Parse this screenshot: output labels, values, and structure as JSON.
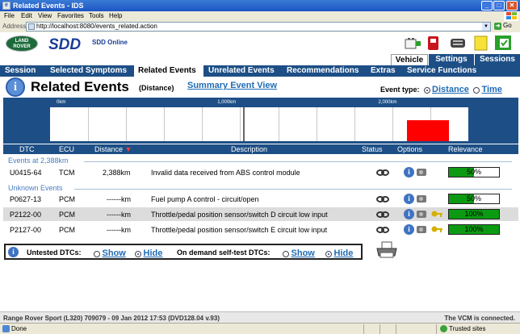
{
  "window": {
    "title": "Related Events - IDS",
    "minimize": "_",
    "maximize": "□",
    "close": "✕"
  },
  "menu": [
    "File",
    "Edit",
    "View",
    "Favorites",
    "Tools",
    "Help"
  ],
  "address": {
    "label": "Address",
    "url": "http://localhost:8080/events_related.action",
    "go": "Go"
  },
  "header": {
    "logo_text": "LAND ROVER",
    "brand": "SDD",
    "brand_sub": "SDD Online",
    "tabs": [
      {
        "label": "Vehicle",
        "active": true
      },
      {
        "label": "Settings",
        "active": false
      },
      {
        "label": "Sessions",
        "active": false
      }
    ]
  },
  "nav": [
    {
      "label": "Session",
      "active": false
    },
    {
      "label": "Selected Symptoms",
      "active": false
    },
    {
      "label": "Related Events",
      "active": true
    },
    {
      "label": "Unrelated Events",
      "active": false
    },
    {
      "label": "Recommendations",
      "active": false
    },
    {
      "label": "Extras",
      "active": false
    },
    {
      "label": "Service Functions",
      "active": false
    }
  ],
  "page": {
    "title": "Related Events",
    "subtitle": "(Distance)",
    "summary_link": "Summary Event View",
    "event_type_label": "Event type:",
    "event_type_options": [
      {
        "label": "Distance",
        "selected": true
      },
      {
        "label": "Time",
        "selected": false
      }
    ]
  },
  "chart_data": {
    "type": "bar",
    "tick_labels": [
      "0km",
      "1,000km",
      "2,000km"
    ],
    "xlim": [
      0,
      2600
    ],
    "marker_km": 1200,
    "events": [
      {
        "start_km": 2220,
        "end_km": 2480,
        "color": "#ff0000"
      }
    ]
  },
  "table": {
    "headers": {
      "dtc": "DTC",
      "ecu": "ECU",
      "distance": "Distance",
      "description": "Description",
      "status": "Status",
      "options": "Options",
      "relevance": "Relevance"
    },
    "groups": [
      {
        "label": "Events at 2,388km",
        "rows": [
          {
            "dtc": "U0415-64",
            "ecu": "TCM",
            "distance": "2,388km",
            "description": "Invalid data received from ABS control module",
            "relevance": "50%",
            "relevance_value": 0.5,
            "has_key": false
          }
        ]
      },
      {
        "label": "Unknown Events",
        "rows": [
          {
            "dtc": "P0627-13",
            "ecu": "PCM",
            "distance": "------km",
            "description": "Fuel pump A control - circuit/open",
            "relevance": "50%",
            "relevance_value": 0.5,
            "has_key": false
          },
          {
            "dtc": "P2122-00",
            "ecu": "PCM",
            "distance": "------km",
            "description": "Throttle/pedal position sensor/switch D circuit low input",
            "relevance": "100%",
            "relevance_value": 1.0,
            "has_key": true
          },
          {
            "dtc": "P2127-00",
            "ecu": "PCM",
            "distance": "------km",
            "description": "Throttle/pedal position sensor/switch E circuit low input",
            "relevance": "100%",
            "relevance_value": 1.0,
            "has_key": true
          }
        ]
      }
    ]
  },
  "untested": {
    "label": "Untested DTCs:",
    "show": "Show",
    "hide": "Hide",
    "selected": "Hide",
    "ondemand_label": "On demand self-test DTCs:",
    "ondemand_show": "Show",
    "ondemand_hide": "Hide",
    "ondemand_selected": "Hide"
  },
  "status": {
    "vehicle_info": "Range Rover Sport (L320) 709079 - 09 Jan 2012 17:53 (DVD128.04 v.93)",
    "vcm": "The VCM is connected."
  },
  "browser_status": {
    "left": "Done",
    "zone": "Trusted sites"
  },
  "colors": {
    "nav_bg": "#1d4f86",
    "link": "#1f6bb5",
    "relevance": "#0c9a12",
    "event": "#ff0000"
  }
}
